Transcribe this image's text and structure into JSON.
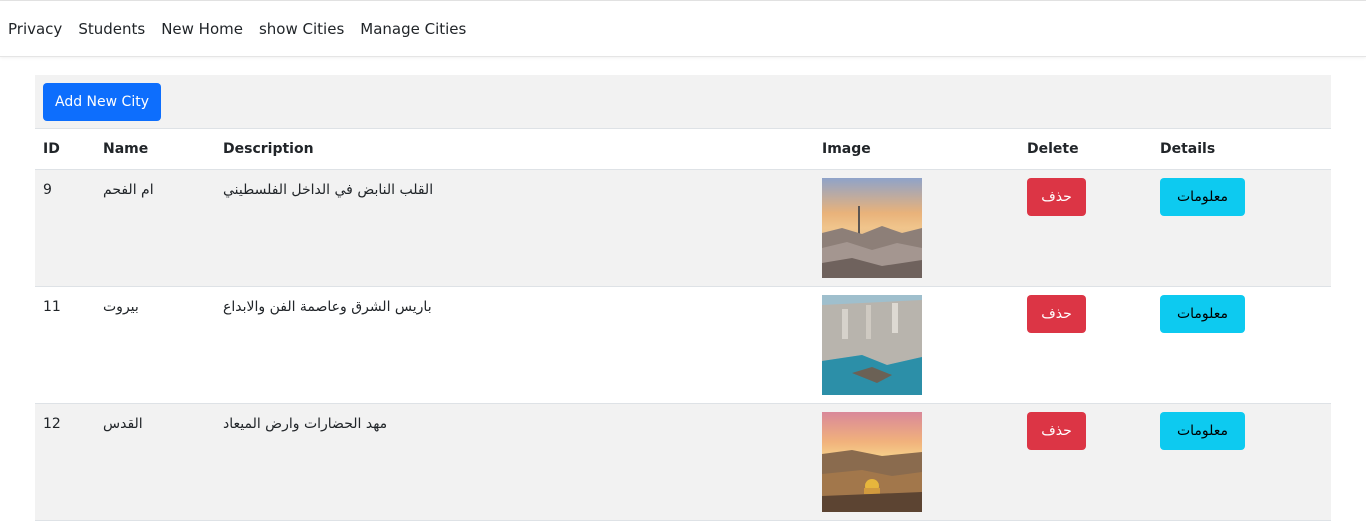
{
  "nav": {
    "items": [
      "Privacy",
      "Students",
      "New Home",
      "show Cities",
      "Manage Cities"
    ]
  },
  "toolbar": {
    "add_label": "Add New City"
  },
  "table": {
    "headers": {
      "id": "ID",
      "name": "Name",
      "description": "Description",
      "image": "Image",
      "delete": "Delete",
      "details": "Details"
    },
    "rows": [
      {
        "id": "9",
        "name": "ام الفحم",
        "description": "القلب النابض في الداخل الفلسطيني",
        "delete_label": "حذف",
        "details_label": "معلومات"
      },
      {
        "id": "11",
        "name": "بيروت",
        "description": "باريس الشرق وعاصمة الفن والابداع",
        "delete_label": "حذف",
        "details_label": "معلومات"
      },
      {
        "id": "12",
        "name": "القدس",
        "description": "مهد الحضارات وارض الميعاد",
        "delete_label": "حذف",
        "details_label": "معلومات"
      }
    ]
  },
  "colors": {
    "primary": "#0d6efd",
    "danger": "#dc3545",
    "info": "#0dcaf0",
    "stripe": "#f2f2f2"
  }
}
